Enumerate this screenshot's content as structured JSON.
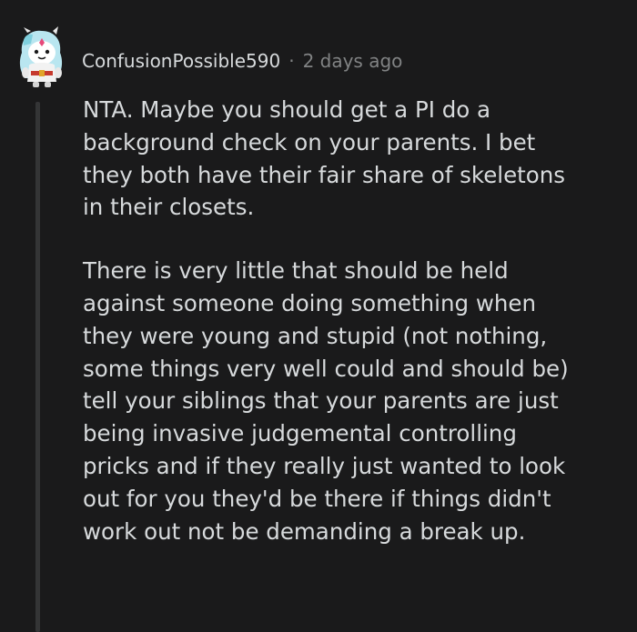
{
  "comment": {
    "author": "ConfusionPossible590",
    "separator": "·",
    "timestamp": "2 days ago",
    "avatar_icon": "snoo-avatar-icon",
    "paragraphs": [
      "NTA. Maybe you should get a PI do a\nbackground check on your parents. I bet\nthey both have their fair share of skeletons\nin their closets.",
      "There is very little that should be held\nagainst someone doing something when\nthey were young and stupid (not nothing,\nsome things very well could and should be)\ntell your siblings that your parents are just\nbeing invasive judgemental controlling\npricks and if they really just wanted to look\nout for you they'd be there if things didn't\nwork out not be demanding a break up."
    ]
  },
  "colors": {
    "background": "#1a1a1b",
    "text": "#d7dadc",
    "muted": "#818384",
    "thread_line": "#343536"
  }
}
